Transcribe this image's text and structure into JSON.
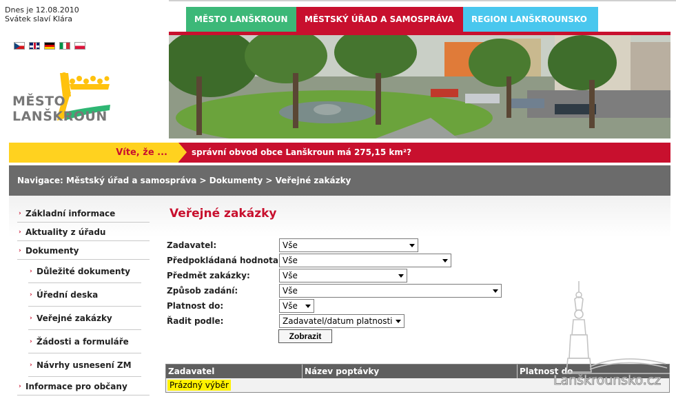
{
  "header": {
    "date_line": "Dnes je 12.08.2010",
    "name_day_line": "Svátek slaví Klára"
  },
  "languages": [
    "cz-flag-icon",
    "gb-flag-icon",
    "de-flag-icon",
    "it-flag-icon",
    "pl-flag-icon"
  ],
  "logo": {
    "text": "MĚSTO LANŠKROUN"
  },
  "top_nav": {
    "tabs": [
      {
        "label": "MĚSTO LANŠKROUN",
        "color": "#3cb878"
      },
      {
        "label": "MĚSTSKÝ ÚŘAD A SAMOSPRÁVA",
        "color": "#c8102e"
      },
      {
        "label": "REGION LANŠKROUNSKO",
        "color": "#49c7ee"
      }
    ]
  },
  "did_you_know": {
    "label": "Víte, že ...",
    "text": "správní obvod obce Lanškroun má 275,15 km²?"
  },
  "breadcrumb": {
    "text": "Navigace: Městský úřad a samospráva > Dokumenty > Veřejné zakázky"
  },
  "sidebar": {
    "items": [
      {
        "label": "Základní informace",
        "level": 1
      },
      {
        "label": "Aktuality z úřadu",
        "level": 1
      },
      {
        "label": "Dokumenty",
        "level": 1
      },
      {
        "label": "Důležité dokumenty",
        "level": 2
      },
      {
        "label": "Úřední deska",
        "level": 2
      },
      {
        "label": "Veřejné zakázky",
        "level": 2
      },
      {
        "label": "Žádosti a formuláře",
        "level": 2
      },
      {
        "label": "Návrhy usnesení ZM",
        "level": 2
      },
      {
        "label": "Informace pro občany",
        "level": 1
      }
    ]
  },
  "main": {
    "title": "Veřejné zakázky",
    "filters": {
      "zadavatel": {
        "label": "Zadavatel:",
        "value": "Vše"
      },
      "hodnota": {
        "label": "Předpokládaná hodnota:",
        "value": "Vše"
      },
      "predmet": {
        "label": "Předmět zakázky:",
        "value": "Vše"
      },
      "zpusob": {
        "label": "Způsob zadání:",
        "value": "Vše"
      },
      "platnost": {
        "label": "Platnost do:",
        "value": "Vše"
      },
      "radit": {
        "label": "Řadit podle:",
        "value": "Zadavatel/datum platnosti"
      }
    },
    "submit_label": "Zobrazit",
    "table": {
      "columns": [
        "Zadavatel",
        "Název poptávky",
        "Platnost do"
      ],
      "empty_text": "Prázdný výběr"
    }
  },
  "watermark": {
    "text": "Lanškrounsko.cz"
  },
  "colors": {
    "brand_red": "#c8102e",
    "brand_green": "#3cb878",
    "brand_cyan": "#49c7ee",
    "brand_yellow": "#ffd21f",
    "breadcrumb_gray": "#6b6b6b"
  }
}
